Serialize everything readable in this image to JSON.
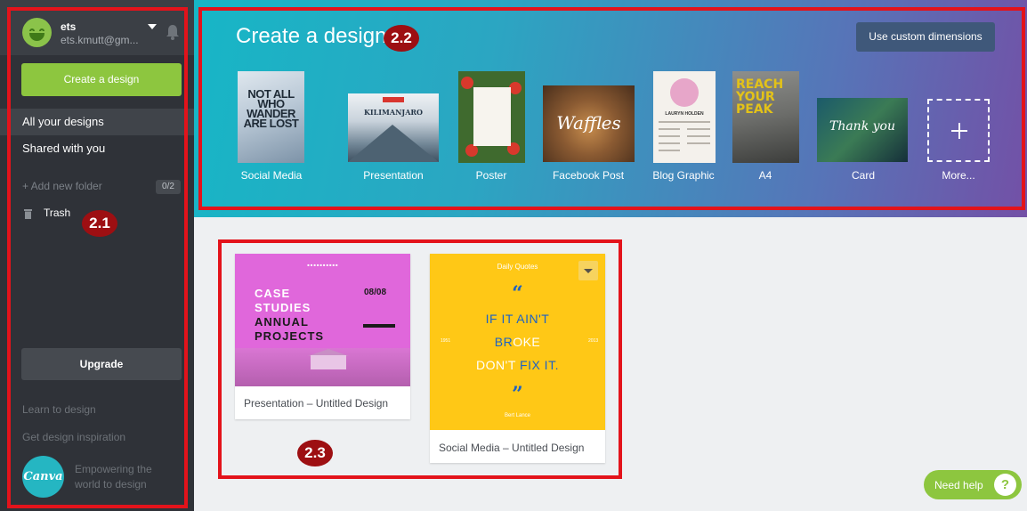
{
  "sidebar": {
    "user_name": "ets",
    "user_email": "ets.kmutt@gm...",
    "create_button": "Create a design",
    "nav": [
      {
        "label": "All your designs",
        "active": true
      },
      {
        "label": "Shared with you",
        "active": false
      }
    ],
    "add_folder": "+ Add new folder",
    "folder_count": "0/2",
    "trash": "Trash",
    "upgrade": "Upgrade",
    "links": [
      "Learn to design",
      "Get design inspiration"
    ],
    "logo_text": "Canva",
    "tagline": "Empowering the world to design"
  },
  "header": {
    "title": "Create a design",
    "custom_button": "Use custom dimensions",
    "design_types": [
      {
        "label": "Social Media",
        "thumb_text": "NOT ALL WHO WANDER ARE LOST",
        "icon": "mountain-image"
      },
      {
        "label": "Presentation",
        "thumb_text": "KILIMANJARO",
        "icon": "mountain-image"
      },
      {
        "label": "Poster",
        "icon": "food-image"
      },
      {
        "label": "Facebook Post",
        "thumb_text": "Waffles",
        "icon": "waffles-image"
      },
      {
        "label": "Blog Graphic",
        "thumb_text": "LAURYN HOLDEN",
        "icon": "resume-image"
      },
      {
        "label": "A4",
        "thumb_text": "REACH YOUR PEAK",
        "icon": "climber-image"
      },
      {
        "label": "Card",
        "thumb_text": "Thank you",
        "icon": "forest-image"
      },
      {
        "label": "More...",
        "icon": "plus-icon"
      }
    ]
  },
  "designs": [
    {
      "caption": "Presentation – Untitled Design",
      "thumb": {
        "line1a": "CASE",
        "line1b": "STUDIES",
        "line2a": "ANNUAL",
        "line2b": "PROJECTS",
        "date": "08/08"
      }
    },
    {
      "caption": "Social Media – Untitled Design",
      "thumb": {
        "header": "Daily Quotes",
        "open_quote": "“",
        "l1": "IF IT AIN'T",
        "l2a": "BR",
        "l2b": "OKE",
        "l3a": "DON'T ",
        "l3b": "FIX IT.",
        "close_quote": "”",
        "author": "Bert Lance",
        "left_side": "1951",
        "right_side": "2013"
      }
    }
  ],
  "annotations": [
    "2.1",
    "2.2",
    "2.3"
  ],
  "help": {
    "label": "Need help",
    "icon": "?"
  },
  "colors": {
    "sidebar_bg": "#2f3238",
    "accent_green": "#8dc63f",
    "annotation_red": "#e3131b",
    "badge_dark_red": "#9d0f12",
    "header_gradient_start": "#17b6c6",
    "header_gradient_end": "#7350a6"
  }
}
